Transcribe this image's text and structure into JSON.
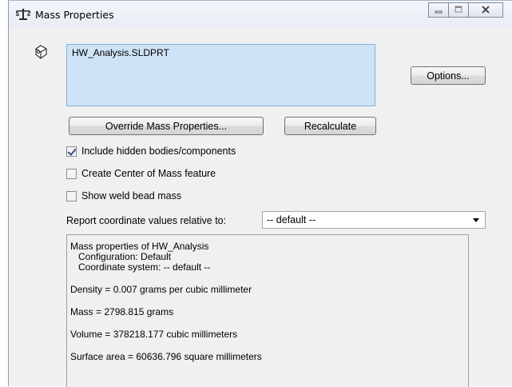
{
  "window": {
    "title": "Mass Properties",
    "icons": {
      "title": "scale-icon",
      "part": "part-icon"
    },
    "controls": {
      "minimize": "minimize-icon",
      "maximize": "maximize-icon",
      "close": "close-icon"
    }
  },
  "selection": {
    "items": [
      "HW_Analysis.SLDPRT"
    ]
  },
  "buttons": {
    "options": "Options...",
    "override": "Override Mass Properties...",
    "recalculate": "Recalculate"
  },
  "checkboxes": {
    "hidden_bodies": {
      "label": "Include hidden bodies/components",
      "checked": true
    },
    "center_of_mass": {
      "label": "Create Center of Mass feature",
      "checked": false
    },
    "weld_bead": {
      "label": "Show weld bead mass",
      "checked": false
    }
  },
  "coordinate": {
    "label": "Report coordinate values relative to:",
    "selected": "-- default --"
  },
  "results": {
    "header": "Mass properties of HW_Analysis",
    "configuration": "Configuration: Default",
    "coord_system": "Coordinate system: -- default --",
    "density": "Density = 0.007 grams per cubic millimeter",
    "mass": "Mass = 2798.815 grams",
    "volume": "Volume = 378218.177 cubic millimeters",
    "surface_area": "Surface area = 60636.796  square millimeters"
  }
}
